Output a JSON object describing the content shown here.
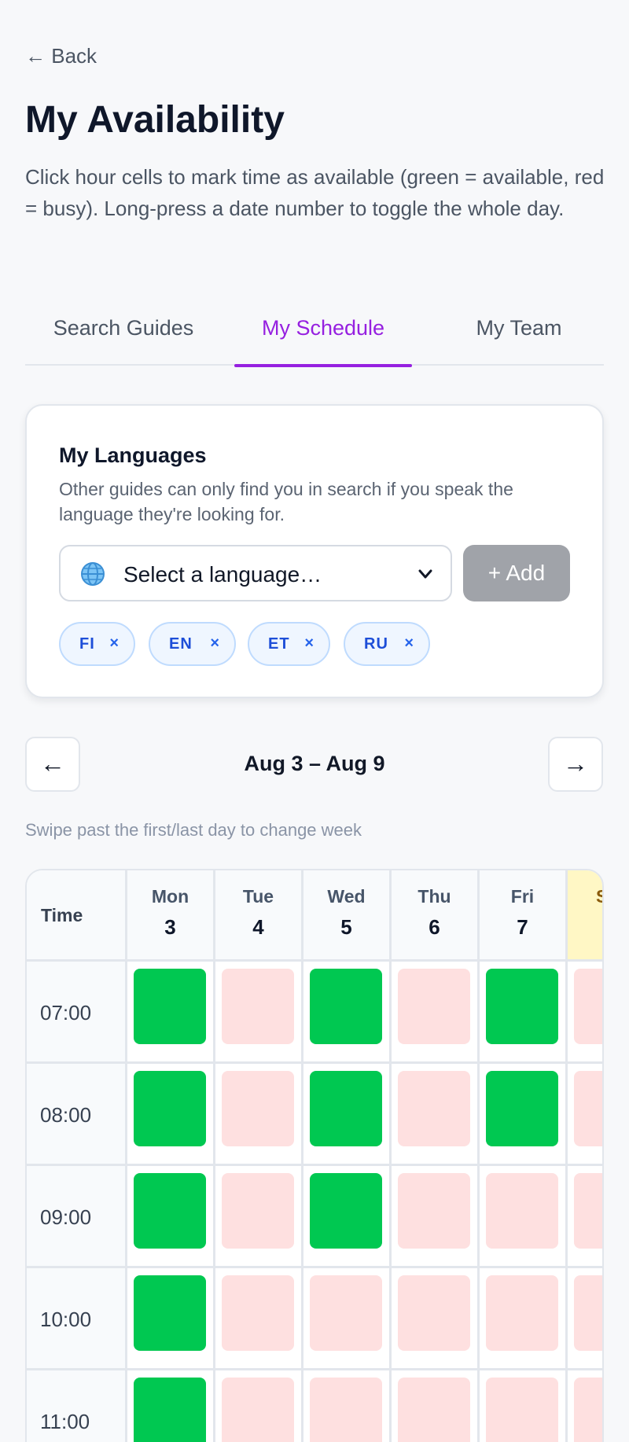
{
  "nav": {
    "back_label": "← Back"
  },
  "page": {
    "title": "My Availability",
    "subtitle": "Click hour cells to mark time as available (green = available, red = busy). Long-press a date number to toggle the whole day."
  },
  "tabs": [
    {
      "label": "Search Guides",
      "active": false
    },
    {
      "label": "My Schedule",
      "active": true
    },
    {
      "label": "My Team",
      "active": false
    }
  ],
  "languages": {
    "title": "My Languages",
    "description": "Other guides can only find you in search if you speak the language they're looking for.",
    "select_value": "Select a language…",
    "add_label": "+ Add",
    "chips": [
      {
        "code": "FI",
        "remove": "×"
      },
      {
        "code": "EN",
        "remove": "×"
      },
      {
        "code": "ET",
        "remove": "×"
      },
      {
        "code": "RU",
        "remove": "×"
      }
    ]
  },
  "week": {
    "prev_label": "←",
    "next_label": "→",
    "range": "Aug 3 – Aug 9",
    "hint": "Swipe past the first/last day to change week"
  },
  "schedule": {
    "time_header": "Time",
    "days": [
      {
        "name": "Mon",
        "date": "3"
      },
      {
        "name": "Tue",
        "date": "4"
      },
      {
        "name": "Wed",
        "date": "5"
      },
      {
        "name": "Thu",
        "date": "6"
      },
      {
        "name": "Fri",
        "date": "7"
      },
      {
        "name": "S",
        "date": ""
      }
    ],
    "rows": [
      {
        "time": "07:00",
        "slots": [
          "available",
          "busy",
          "available",
          "busy",
          "available",
          "busy"
        ]
      },
      {
        "time": "08:00",
        "slots": [
          "available",
          "busy",
          "available",
          "busy",
          "available",
          "busy"
        ]
      },
      {
        "time": "09:00",
        "slots": [
          "available",
          "busy",
          "available",
          "busy",
          "busy",
          "busy"
        ]
      },
      {
        "time": "10:00",
        "slots": [
          "available",
          "busy",
          "busy",
          "busy",
          "busy",
          "busy"
        ]
      },
      {
        "time": "11:00",
        "slots": [
          "available",
          "busy",
          "busy",
          "busy",
          "busy",
          "busy"
        ]
      }
    ]
  },
  "colors": {
    "accent": "#9620e0",
    "available": "#00c851",
    "busy": "#fee0e0",
    "weekend_header": "#fff7c5"
  }
}
